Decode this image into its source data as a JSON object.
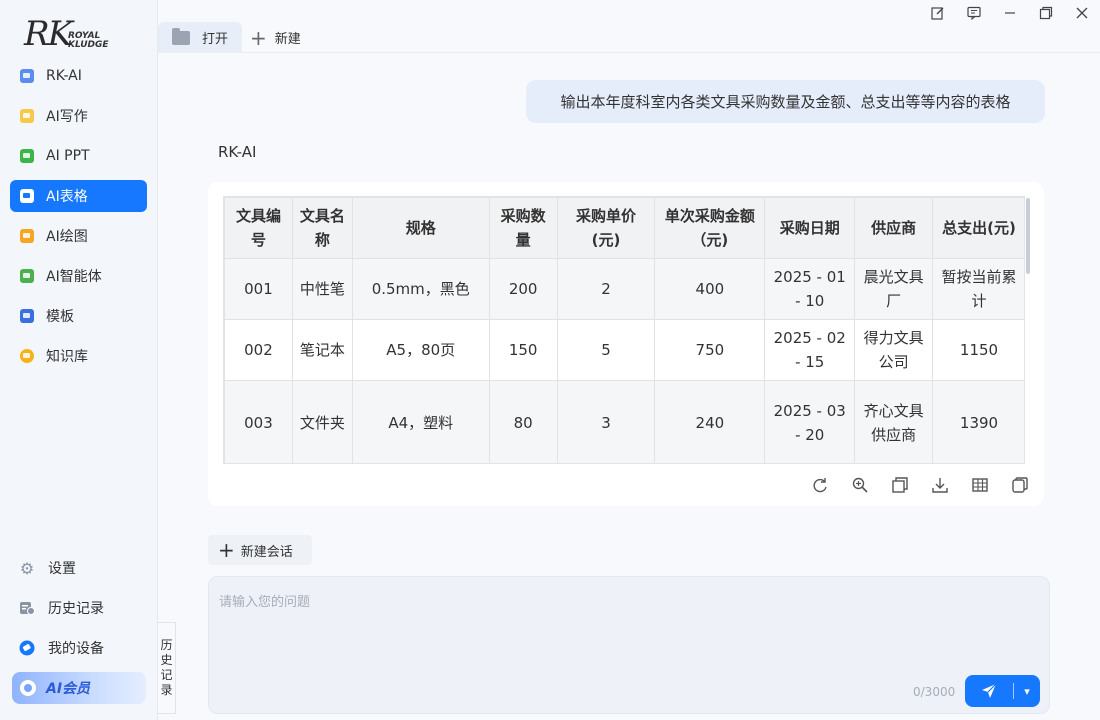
{
  "logo": {
    "main": "RK",
    "line1": "ROYAL",
    "line2": "KLUDGE"
  },
  "sidebar": {
    "items": [
      {
        "label": "RK-AI",
        "icon": "chat-icon",
        "color": "#5b8def"
      },
      {
        "label": "AI写作",
        "icon": "writing-icon",
        "color": "#f7c94a"
      },
      {
        "label": "AI PPT",
        "icon": "ppt-icon",
        "color": "#3bb54a"
      },
      {
        "label": "AI表格",
        "icon": "table-icon",
        "color": "#1677ff",
        "active": true
      },
      {
        "label": "AI绘图",
        "icon": "paint-icon",
        "color": "#f5a623"
      },
      {
        "label": "AI智能体",
        "icon": "agent-icon",
        "color": "#4caf50"
      },
      {
        "label": "模板",
        "icon": "template-icon",
        "color": "#3a6fe0"
      },
      {
        "label": "知识库",
        "icon": "knowledge-icon",
        "color": "#f5b21b"
      }
    ],
    "bottom": [
      {
        "label": "设置",
        "icon": "gear-icon"
      },
      {
        "label": "历史记录",
        "icon": "history-icon"
      },
      {
        "label": "我的设备",
        "icon": "device-icon"
      }
    ],
    "member": "AI会员"
  },
  "tabs": {
    "open": "打开",
    "new": "新建"
  },
  "chat": {
    "user_message": "输出本年度科室内各类文具采购数量及金额、总支出等等内容的表格",
    "bot_name": "RK-AI",
    "table": {
      "headers": [
        "文具编号",
        "文具名称",
        "规格",
        "采购数量",
        "采购单价(元)",
        "单次采购金额（元)",
        "采购日期",
        "供应商",
        "总支出(元)"
      ],
      "rows": [
        [
          "001",
          "中性笔",
          "0.5mm，黑色",
          "200",
          "2",
          "400",
          "2025 - 01 - 10",
          "晨光文具厂",
          "暂按当前累计"
        ],
        [
          "002",
          "笔记本",
          "A5，80页",
          "150",
          "5",
          "750",
          "2025 - 02 - 15",
          "得力文具公司",
          "1150"
        ],
        [
          "003",
          "文件夹",
          "A4，塑料",
          "80",
          "3",
          "240",
          "2025 - 03 - 20",
          "齐心文具供应商",
          "1390"
        ]
      ]
    },
    "actions": [
      "refresh-icon",
      "zoom-icon",
      "copy-icon",
      "download-icon",
      "table-icon",
      "duplicate-icon"
    ]
  },
  "new_chat": "新建会话",
  "input": {
    "placeholder": "请输入您的问题",
    "counter": "0/3000"
  },
  "history_tab": "历史记录",
  "colors": {
    "accent": "#1677ff",
    "bubble": "#e6edfa"
  }
}
